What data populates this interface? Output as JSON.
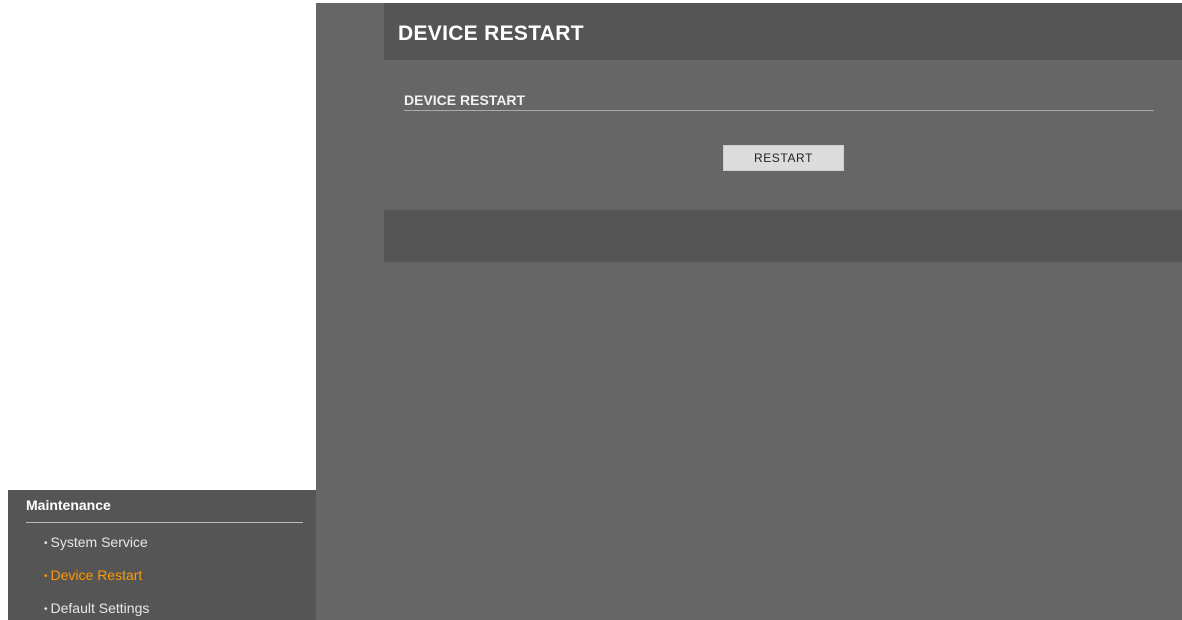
{
  "header": {
    "title": "DEVICE RESTART"
  },
  "section": {
    "title": "DEVICE RESTART",
    "restart_label": "RESTART"
  },
  "sidebar": {
    "heading": "Maintenance",
    "bullet": "•",
    "items": [
      {
        "label": "System Service",
        "active": false
      },
      {
        "label": "Device Restart",
        "active": true
      },
      {
        "label": "Default Settings",
        "active": false
      }
    ]
  },
  "colors": {
    "active_item": "#ff9900",
    "panel_dark": "#555555",
    "panel_main": "#666666"
  }
}
